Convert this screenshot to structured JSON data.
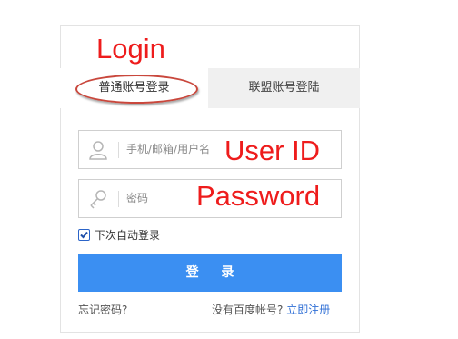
{
  "annotations": {
    "login": "Login",
    "user_id": "User ID",
    "password": "Password"
  },
  "tabs": {
    "normal": "普通账号登录",
    "union": "联盟账号登陆"
  },
  "fields": {
    "username_placeholder": "手机/邮箱/用户名",
    "password_placeholder": "密码"
  },
  "remember": {
    "label": "下次自动登录",
    "checked": true
  },
  "login_button": "登 录",
  "footer": {
    "forgot": "忘记密码?",
    "no_account": "没有百度帐号?",
    "register": "立即注册"
  },
  "icons": {
    "user": "user-icon",
    "key": "key-icon",
    "check": "check-icon"
  },
  "colors": {
    "annotation": "#ee1c1c",
    "button": "#3b8ff2",
    "link": "#2f6fd6",
    "highlight_ring": "#c9473c"
  }
}
